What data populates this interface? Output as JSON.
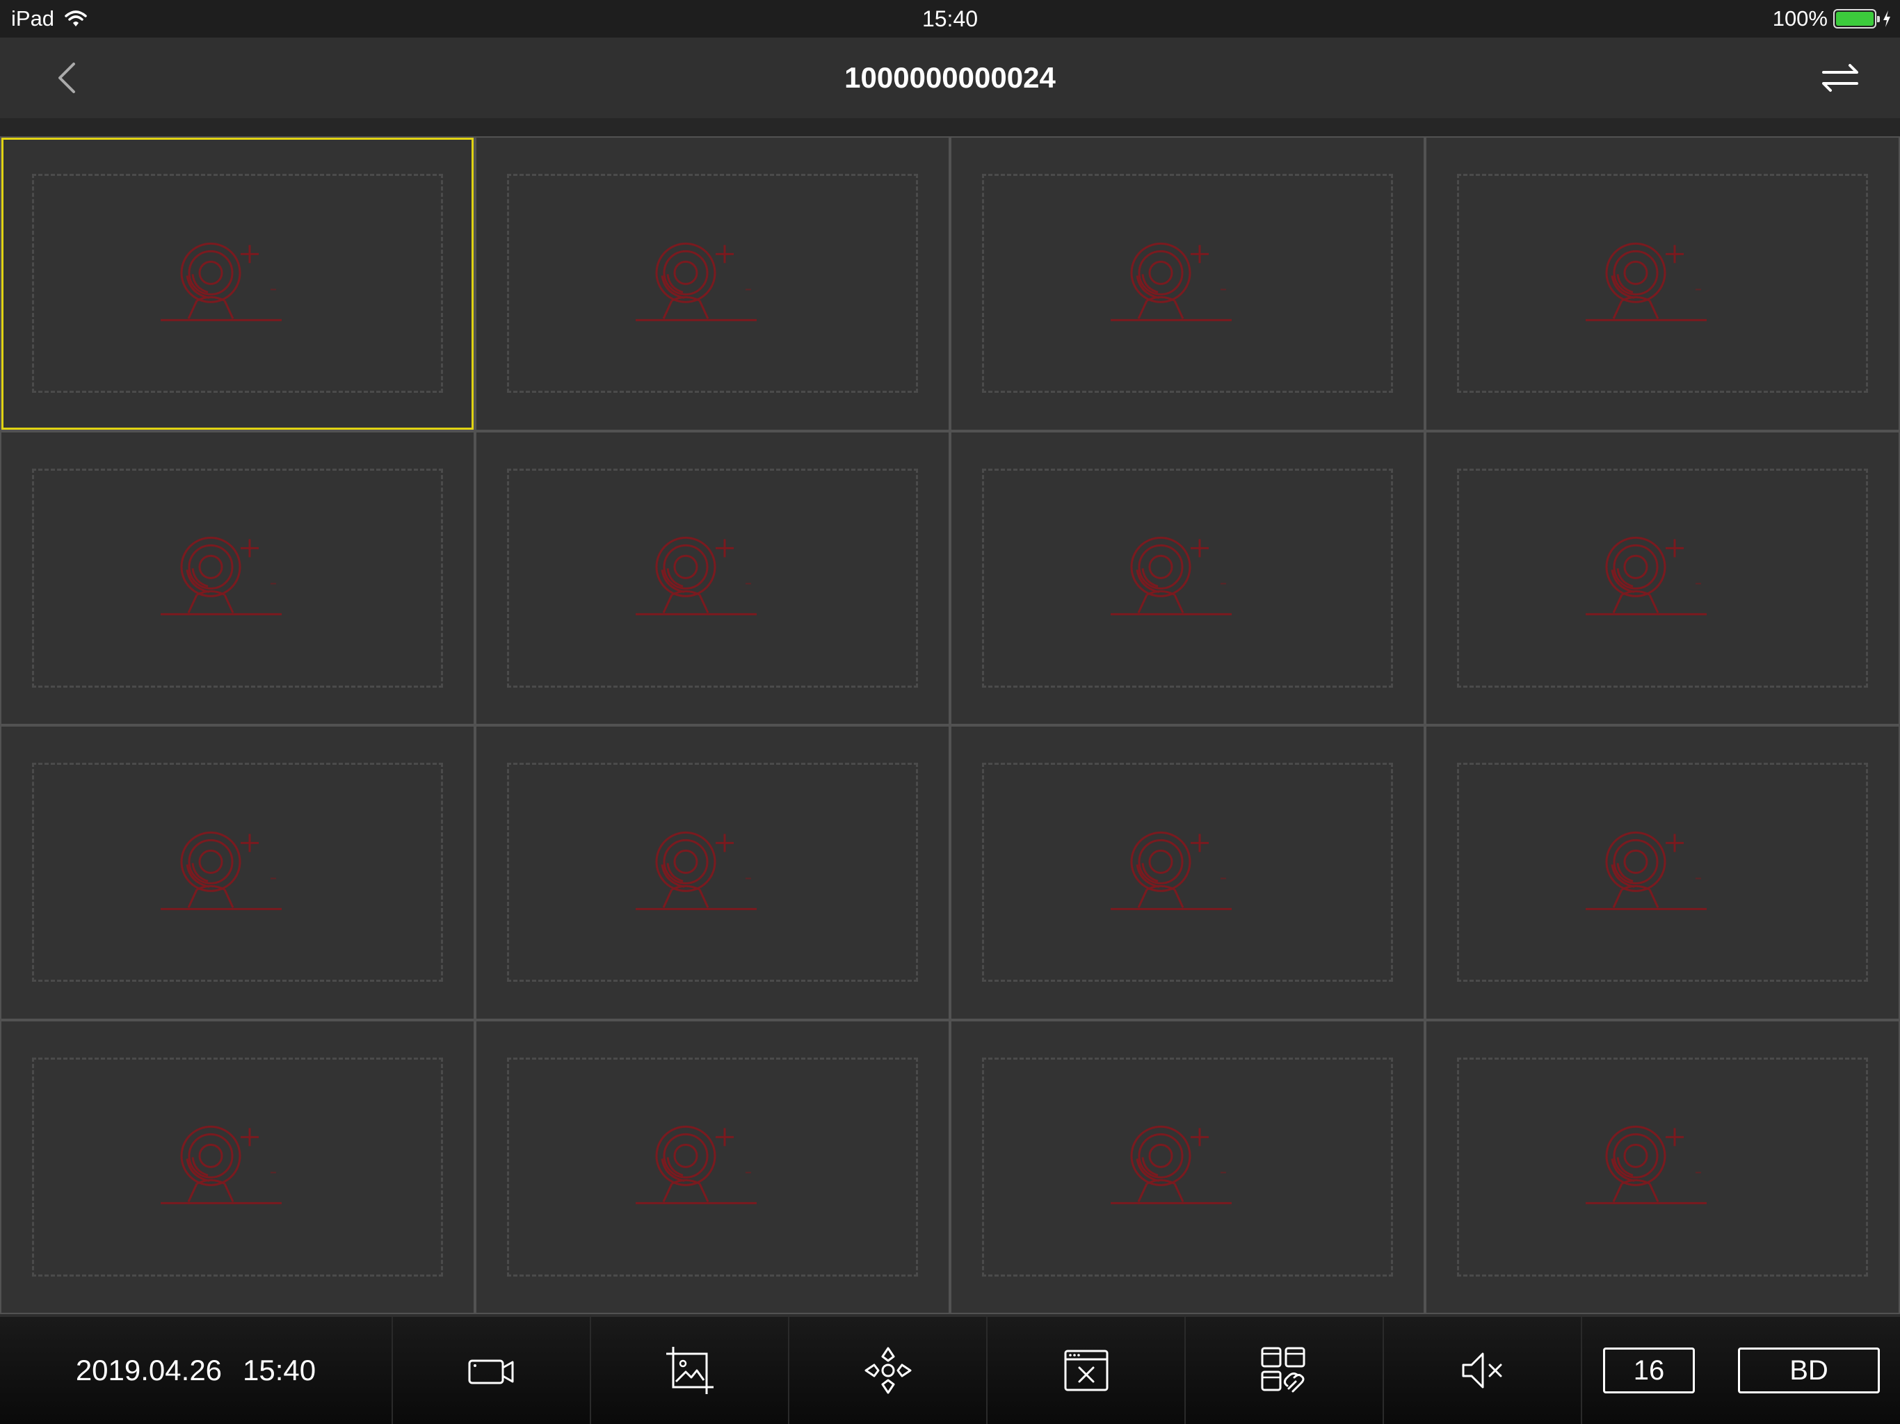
{
  "status_bar": {
    "device": "iPad",
    "time": "15:40",
    "battery": "100%",
    "battery_level": 1.0
  },
  "nav": {
    "title": "1000000000024",
    "back_icon": "chevron-left-icon",
    "switch_icon": "swap-arrows-icon"
  },
  "grid": {
    "rows": 4,
    "columns": 4,
    "selected_index": 0,
    "cell_icon": "add-camera-icon",
    "accent_color": "#e0d313",
    "icon_color": "#7a1a1f"
  },
  "toolbar": {
    "date": "2019.04.26",
    "time": "15:40",
    "buttons": [
      {
        "name": "record-button",
        "icon": "video-camera-icon"
      },
      {
        "name": "snapshot-button",
        "icon": "image-crop-icon"
      },
      {
        "name": "ptz-button",
        "icon": "ptz-direction-icon"
      },
      {
        "name": "close-window-button",
        "icon": "window-close-icon"
      },
      {
        "name": "window-link-button",
        "icon": "grid-link-icon"
      },
      {
        "name": "mute-button",
        "icon": "speaker-mute-icon"
      }
    ],
    "split_count": "16",
    "quality": "BD"
  }
}
